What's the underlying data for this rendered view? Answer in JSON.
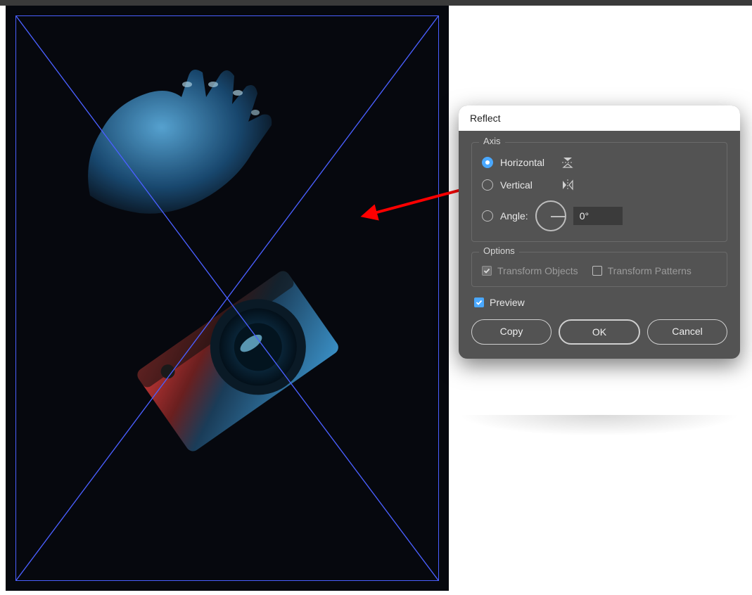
{
  "dialog": {
    "title": "Reflect",
    "axis": {
      "group_label": "Axis",
      "horizontal_label": "Horizontal",
      "vertical_label": "Vertical",
      "angle_label": "Angle:",
      "angle_value": "0°",
      "selected": "horizontal"
    },
    "options": {
      "group_label": "Options",
      "transform_objects_label": "Transform Objects",
      "transform_objects_checked": true,
      "transform_objects_enabled": false,
      "transform_patterns_label": "Transform Patterns",
      "transform_patterns_checked": false,
      "transform_patterns_enabled": false
    },
    "preview": {
      "label": "Preview",
      "checked": true
    },
    "buttons": {
      "copy": "Copy",
      "ok": "OK",
      "cancel": "Cancel"
    }
  },
  "annotations": {
    "arrow1_color": "#ff0000",
    "arrow2_color": "#ff0000"
  }
}
